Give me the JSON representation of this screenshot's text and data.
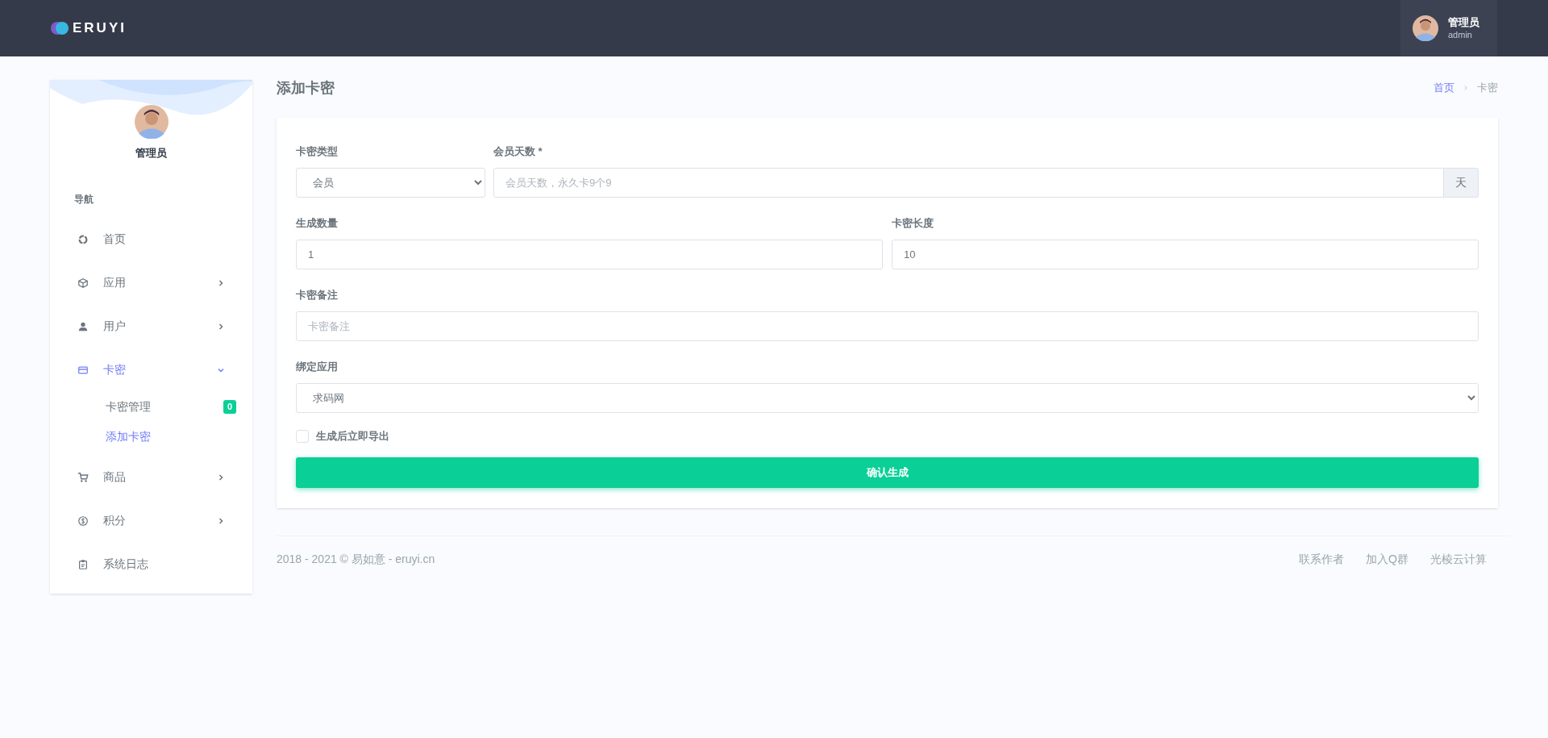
{
  "header": {
    "logo": "ERUYI",
    "user": {
      "name": "管理员",
      "role": "admin"
    }
  },
  "sidebar": {
    "profile_name": "管理员",
    "section_title": "导航",
    "items": [
      {
        "label": "首页",
        "has_children": false,
        "expanded": false,
        "selected": false
      },
      {
        "label": "应用",
        "has_children": true,
        "expanded": false,
        "selected": false
      },
      {
        "label": "用户",
        "has_children": true,
        "expanded": false,
        "selected": false
      },
      {
        "label": "卡密",
        "has_children": true,
        "expanded": true,
        "selected": true,
        "children": [
          {
            "label": "卡密管理",
            "badge": "0",
            "selected": false
          },
          {
            "label": "添加卡密",
            "selected": true
          }
        ]
      },
      {
        "label": "商品",
        "has_children": true,
        "expanded": false,
        "selected": false
      },
      {
        "label": "积分",
        "has_children": true,
        "expanded": false,
        "selected": false
      },
      {
        "label": "系统日志",
        "has_children": false,
        "expanded": false,
        "selected": false
      }
    ]
  },
  "page": {
    "title": "添加卡密",
    "breadcrumb": [
      {
        "label": "首页",
        "selected": false
      },
      {
        "label": "卡密",
        "selected": true
      }
    ]
  },
  "form": {
    "card_type": {
      "label": "卡密类型",
      "value": "会员"
    },
    "member_days": {
      "label": "会员天数 *",
      "placeholder": "会员天数，永久卡9个9",
      "addon": "天"
    },
    "count": {
      "label": "生成数量",
      "value": "1"
    },
    "length": {
      "label": "卡密长度",
      "value": "10"
    },
    "note": {
      "label": "卡密备注",
      "placeholder": "卡密备注"
    },
    "app": {
      "label": "绑定应用",
      "value": "求码网"
    },
    "export": {
      "label": "生成后立即导出",
      "checked": false
    },
    "submit": "确认生成"
  },
  "footer": {
    "copyright": "2018 - 2021 © 易如意 - eruyi.cn",
    "links": [
      "联系作者",
      "加入Q群",
      "光棱云计算"
    ]
  }
}
